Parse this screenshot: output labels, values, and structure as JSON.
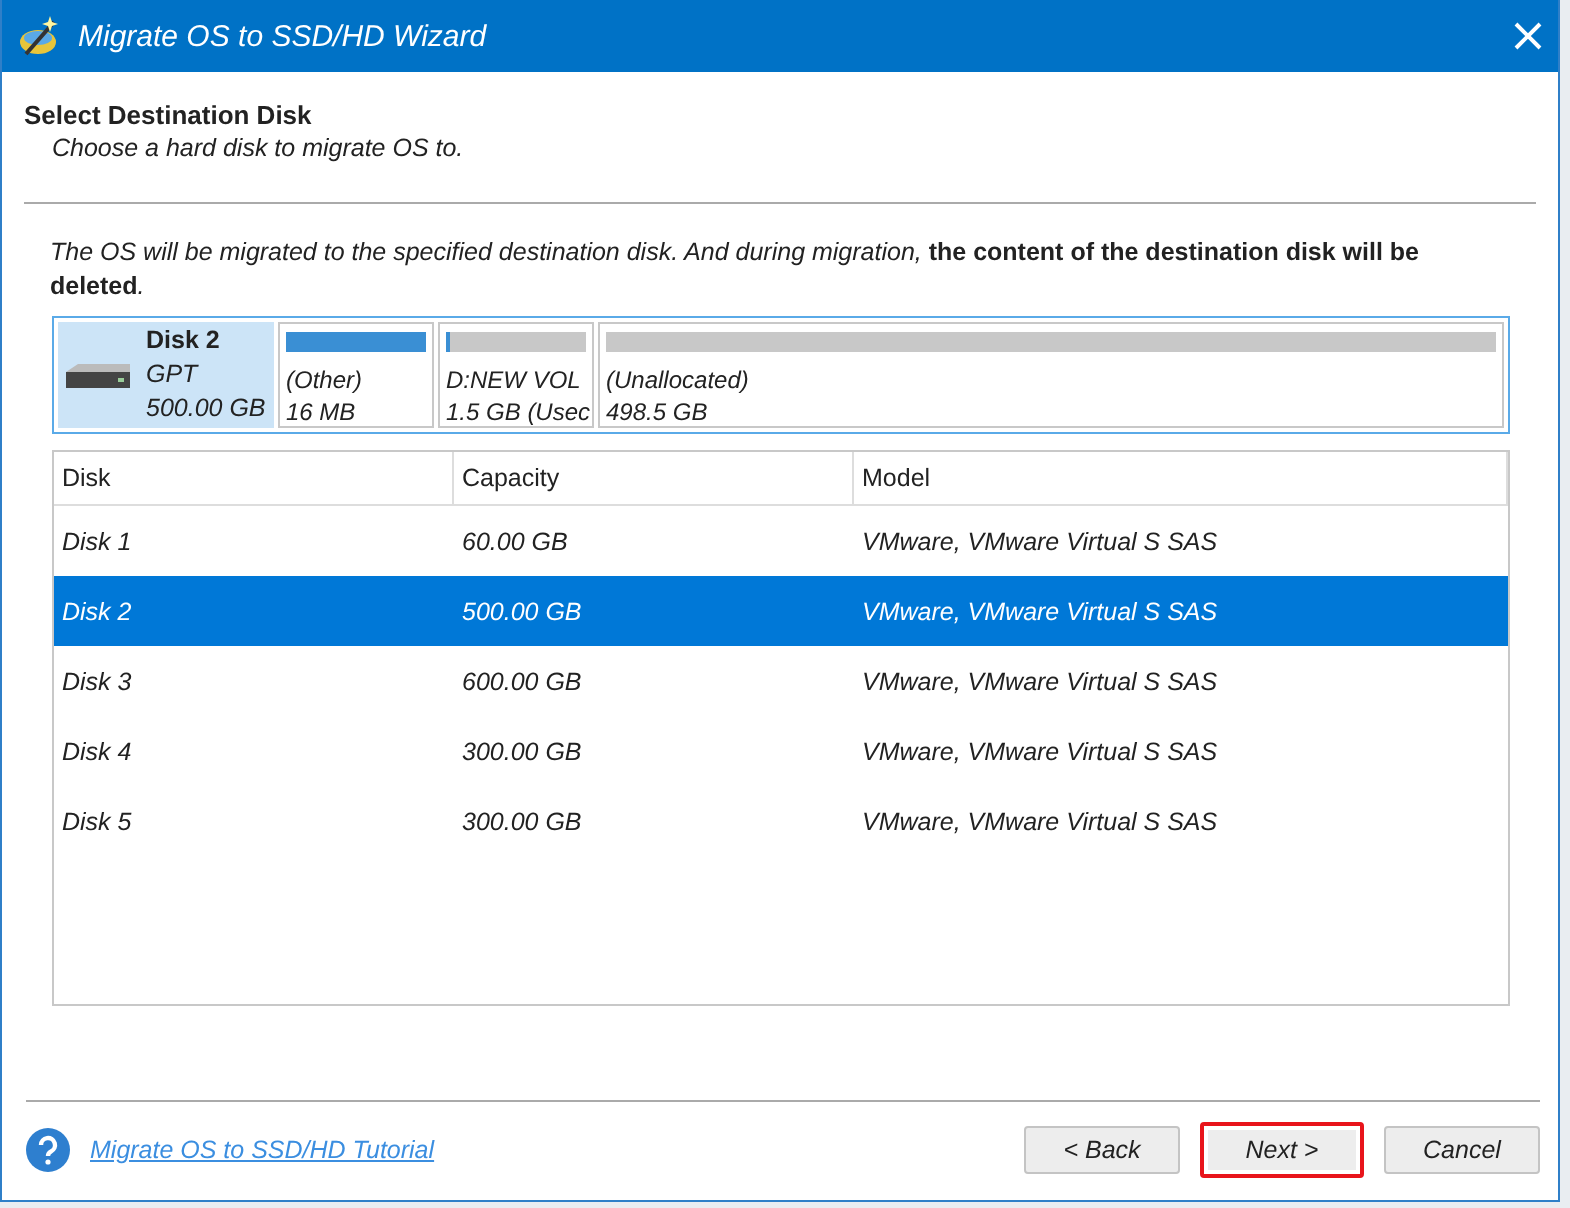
{
  "window": {
    "title": "Migrate OS to SSD/HD Wizard"
  },
  "header": {
    "title": "Select Destination Disk",
    "subtitle": "Choose a hard disk to migrate OS to."
  },
  "notice": "The OS will be migrated to the specified destination disk. And during migration, **the content of the destination disk will be deleted**.",
  "disk_map": {
    "name": "Disk 2",
    "style": "GPT",
    "size": "500.00 GB",
    "selected": true,
    "partitions": [
      {
        "label": "(Other)",
        "size": "16 MB",
        "level": 1
      },
      {
        "label": "D:NEW VOL",
        "size": "1.5 GB (Usec",
        "level": 0.03
      },
      {
        "label": "(Unallocated)",
        "size": "498.5 GB",
        "level": 0
      }
    ]
  },
  "table": {
    "columns": [
      "Disk",
      "Capacity",
      "Model"
    ],
    "rows": [
      {
        "cells": [
          "Disk 1",
          "60.00 GB",
          "VMware, VMware Virtual S SAS"
        ],
        "selected": false
      },
      {
        "cells": [
          "Disk 2",
          "500.00 GB",
          "VMware, VMware Virtual S SAS"
        ],
        "selected": true
      },
      {
        "cells": [
          "Disk 3",
          "600.00 GB",
          "VMware, VMware Virtual S SAS"
        ],
        "selected": false
      },
      {
        "cells": [
          "Disk 4",
          "300.00 GB",
          "VMware, VMware Virtual S SAS"
        ],
        "selected": false
      },
      {
        "cells": [
          "Disk 5",
          "300.00 GB",
          "VMware, VMware Virtual S SAS"
        ],
        "selected": false
      }
    ]
  },
  "footer": {
    "help_link": "Migrate OS to SSD/HD Tutorial",
    "buttons": [
      {
        "label": "< Back",
        "highlighted": false
      },
      {
        "label": "Next >",
        "highlighted": true
      },
      {
        "label": "Cancel",
        "highlighted": false
      }
    ]
  }
}
